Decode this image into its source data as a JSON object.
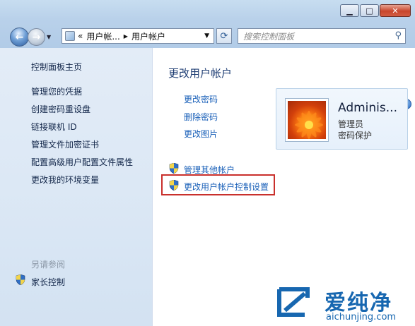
{
  "window": {
    "minimize_glyph": "▁",
    "maximize_glyph": "□",
    "close_glyph": "✕"
  },
  "address": {
    "root_glyph": "«",
    "crumb_1": "用户帐...",
    "sep_glyph": "▶",
    "crumb_2": "用户帐户",
    "dropdown_glyph": "▼"
  },
  "search": {
    "placeholder": "搜索控制面板"
  },
  "help": {
    "glyph": "?"
  },
  "sidebar": {
    "items": [
      {
        "label": "控制面板主页"
      },
      {
        "label": "管理您的凭据"
      },
      {
        "label": "创建密码重设盘"
      },
      {
        "label": "链接联机 ID"
      },
      {
        "label": "管理文件加密证书"
      },
      {
        "label": "配置高级用户配置文件属性"
      },
      {
        "label": "更改我的环境变量"
      }
    ],
    "see_also": "另请参阅",
    "parental_controls": "家长控制"
  },
  "main": {
    "title": "更改用户帐户",
    "links": [
      {
        "label": "更改密码"
      },
      {
        "label": "删除密码"
      },
      {
        "label": "更改图片"
      }
    ],
    "manage_other": "管理其他帐户",
    "uac_settings": "更改用户帐户控制设置"
  },
  "user": {
    "name": "Adminis...",
    "role": "管理员",
    "status": "密码保护"
  },
  "watermark": {
    "title": "爱纯净",
    "url": "aichunjing.com"
  },
  "colors": {
    "link": "#1b61b9",
    "highlight": "#c9302c",
    "brand": "#1767b0"
  }
}
